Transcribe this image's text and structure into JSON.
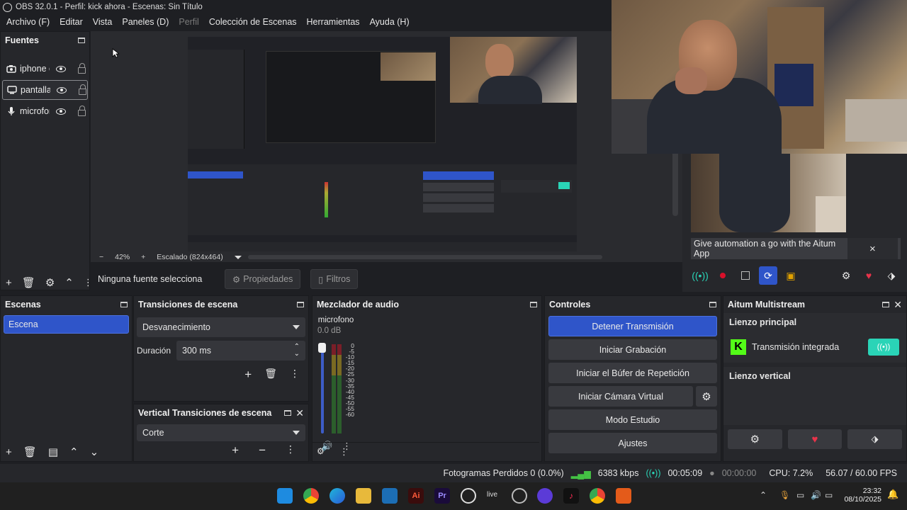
{
  "window": {
    "title": "OBS 32.0.1 - Perfil: kick ahora - Escenas: Sin Título"
  },
  "menu": [
    {
      "label": "Archivo (F)",
      "disabled": false
    },
    {
      "label": "Editar",
      "disabled": false
    },
    {
      "label": "Vista",
      "disabled": false
    },
    {
      "label": "Paneles (D)",
      "disabled": false
    },
    {
      "label": "Perfil",
      "disabled": true
    },
    {
      "label": "Colección de Escenas",
      "disabled": false
    },
    {
      "label": "Herramientas",
      "disabled": false
    },
    {
      "label": "Ayuda (H)",
      "disabled": false
    }
  ],
  "sources": {
    "title": "Fuentes",
    "items": [
      {
        "name": "iphone c",
        "icon": "camera-icon"
      },
      {
        "name": "pantalla",
        "icon": "monitor-icon",
        "selected": true
      },
      {
        "name": "microfor",
        "icon": "microphone-icon"
      }
    ]
  },
  "preview": {
    "zoom": "42%",
    "scale": "Escalado (824x464)"
  },
  "source_props": {
    "label": "Ninguna fuente selecciona",
    "properties": "Propiedades",
    "filters": "Filtros"
  },
  "notification": {
    "text": "Give automation a go with the Aitum App",
    "close": "×"
  },
  "scenes": {
    "title": "Escenas",
    "items": [
      "Escena"
    ]
  },
  "transitions": {
    "title": "Transiciones de escena",
    "selected": "Desvanecimiento",
    "duration_label": "Duración",
    "duration_value": "300 ms"
  },
  "vertical_transitions": {
    "title": "Vertical Transiciones de escena",
    "selected": "Corte"
  },
  "mixer": {
    "title": "Mezclador de audio",
    "channel": "microfono",
    "db": "0.0 dB",
    "scale": [
      "0",
      "-5",
      "-10",
      "-15",
      "-20",
      "-25",
      "-30",
      "-35",
      "-40",
      "-45",
      "-50",
      "-55",
      "-60"
    ]
  },
  "controls": {
    "title": "Controles",
    "buttons": [
      "Detener Transmisión",
      "Iniciar Grabación",
      "Iniciar el Búfer de Repetición",
      "Iniciar Cámara Virtual",
      "Modo Estudio",
      "Ajustes"
    ]
  },
  "aitum": {
    "title": "Aitum Multistream",
    "main_canvas": "Lienzo principal",
    "integrated": "Transmisión integrada",
    "vertical_canvas": "Lienzo vertical"
  },
  "status": {
    "dropped": "Fotogramas Perdidos 0 (0.0%)",
    "bitrate": "6383 kbps",
    "stream_time": "00:05:09",
    "rec_time": "00:00:00",
    "cpu": "CPU: 7.2%",
    "fps": "56.07 / 60.00 FPS"
  },
  "taskbar": {
    "time": "23:32",
    "date": "08/10/2025",
    "live_label": "live"
  },
  "colors": {
    "accent": "#2f55c9",
    "panel": "#26272b",
    "kick_green": "#53fc18",
    "teal": "#2ad4b7"
  }
}
